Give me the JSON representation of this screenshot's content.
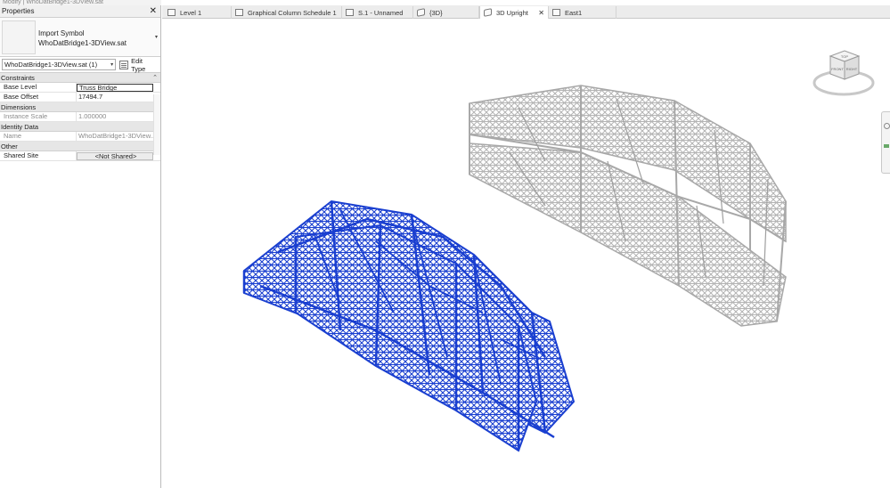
{
  "window": {
    "caption": "Modify | WhoDatBridge1-3DView.sat"
  },
  "properties": {
    "title": "Properties",
    "close": "✕",
    "type_selector": {
      "line1": "Import Symbol",
      "line2": "WhoDatBridge1-3DView.sat",
      "arrow": "▾"
    },
    "instance_filter": "WhoDatBridge1-3DView.sat (1)",
    "instance_arrow": "▾",
    "edit_type": "Edit Type",
    "groups": {
      "constraints": "Constraints",
      "dimensions": "Dimensions",
      "identity": "Identity Data",
      "other": "Other"
    },
    "collapse_glyph": "⌃",
    "rows": {
      "base_level_label": "Base Level",
      "base_level_value": "Truss Bridge",
      "base_offset_label": "Base Offset",
      "base_offset_value": "17494.7",
      "instance_scale_label": "Instance Scale",
      "instance_scale_value": "1.000000",
      "name_label": "Name",
      "name_value": "WhoDatBridge1-3DView...",
      "shared_site_label": "Shared Site",
      "shared_site_value": "<Not Shared>"
    }
  },
  "tabs": [
    {
      "label": "Level 1",
      "icon": "floor-plan-icon"
    },
    {
      "label": "Graphical Column Schedule 1",
      "icon": "schedule-icon"
    },
    {
      "label": "S.1 - Unnamed",
      "icon": "sheet-icon"
    },
    {
      "label": "{3D}",
      "icon": "3d-view-icon"
    },
    {
      "label": "3D Upright",
      "icon": "3d-view-icon",
      "close": "✕"
    },
    {
      "label": "East1",
      "icon": "elevation-icon"
    }
  ],
  "viewcube": {
    "top": "TOP",
    "front": "FRONT",
    "right": "RIGHT"
  },
  "colors": {
    "selected_bridge": "#1a3fd0",
    "unselected_bridge": "#b4b4b4"
  }
}
